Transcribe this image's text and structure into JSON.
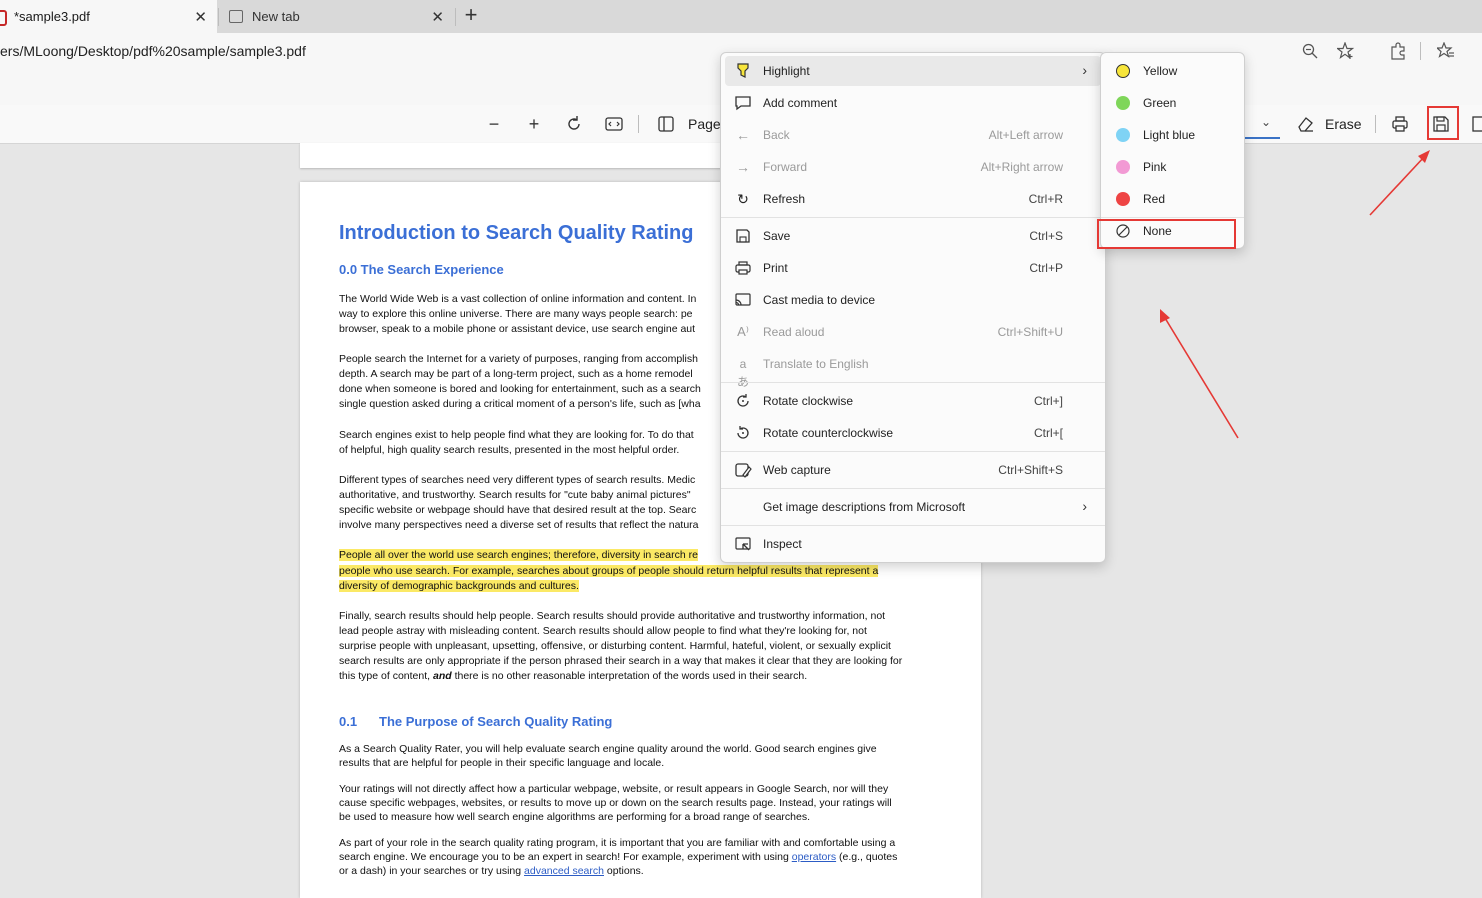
{
  "tabs": [
    {
      "title": "*sample3.pdf",
      "close": "✕"
    },
    {
      "title": "New tab",
      "close": "✕"
    }
  ],
  "new_tab_symbol": "+",
  "address": {
    "url": "ers/MLoong/Desktop/pdf%20sample/sample3.pdf"
  },
  "pdf_toolbar": {
    "page_label": "Page",
    "erase_label": "Erase",
    "icons": [
      "zoom-out-icon",
      "zoom-in-icon",
      "rotate-icon",
      "fit-width-icon",
      "page-view-icon",
      "eraser-icon",
      "print-icon",
      "save-icon"
    ]
  },
  "document": {
    "title": "Introduction to Search Quality Rating",
    "section_00": "0.0 The Search Experience",
    "p1": [
      "The World Wide Web is a vast collection of online information and content.  In",
      "way to explore this online universe.  There are many ways people search: pe",
      "browser, speak to a mobile phone or assistant device, use search engine aut"
    ],
    "p2": [
      "People search the Internet  for a variety of purposes, ranging from accomplish",
      "depth.  A search may be part of a long-term project, such as a home remodel",
      "done when someone is bored and looking for entertainment, such as a search",
      "single question asked during a critical moment of a person's life, such as [wha"
    ],
    "p3": [
      "Search engines exist to help people find what they are looking for.  To do that",
      "of helpful, high quality search results, presented in the most helpful order."
    ],
    "p4": [
      "Different types of searches need very different types of search results.  Medic",
      "authoritative, and trustworthy.  Search results for \"cute baby animal pictures\"",
      "specific website or webpage should have that desired result at the top.  Searc",
      "involve many perspectives need a diverse set of results that reflect the natura"
    ],
    "p5": [
      "People all over the world use search engines; therefore, diversity in search re",
      "people who use search.  For example, searches about groups of people should return helpful results that represent a",
      "diversity of demographic backgrounds and cultures."
    ],
    "p6": [
      "Finally, search results should help people.  Search results should provide authoritative and trustworthy information, not",
      "lead people astray with misleading content.  Search results should allow people to find what they're looking for, not",
      "surprise people with unpleasant, upsetting, offensive, or disturbing content.  Harmful, hateful, violent, or sexually explicit",
      "search results are only appropriate if the person phrased their search in a way that makes it clear that they are looking for"
    ],
    "p6_last_a": "this type of content,",
    "p6_last_b": "and",
    "p6_last_c": "there is no other reasonable interpretation of the words used in their search.",
    "section_01_num": "0.1",
    "section_01": "The Purpose of Search Quality Rating",
    "p7": [
      "As a Search Quality Rater, you will help evaluate search engine quality around the world.  Good search engines give",
      "results that are helpful for people in their specific language and locale."
    ],
    "p8": [
      "Your ratings will not directly affect how a particular webpage, website, or result appears in Google Search, nor will they",
      "cause specific webpages, websites, or results to move up or down on the search results page.  Instead, your ratings will",
      "be used to measure how well search engine algorithms are performing for a broad range of searches."
    ],
    "p9_l1": "As part of your role in the search quality rating program, it is important that you are familiar with and comfortable using a",
    "p9_l2a": "search engine.  We encourage you to be an expert in search!  For example, experiment with using",
    "p9_l2_link": "operators",
    "p9_l2b": "(e.g., quotes",
    "p9_l3a": "or a dash) in your searches or try using",
    "p9_l3_link": "advanced search",
    "p9_l3b": "options."
  },
  "context_menu": {
    "items": [
      {
        "label": "Highlight",
        "shortcut": "",
        "icon": "highlighter-icon",
        "arrow": "›"
      },
      {
        "label": "Add comment",
        "shortcut": "",
        "icon": "comment-icon"
      },
      {
        "label": "Back",
        "shortcut": "Alt+Left arrow",
        "icon": "back-arrow-icon"
      },
      {
        "label": "Forward",
        "shortcut": "Alt+Right arrow",
        "icon": "forward-arrow-icon"
      },
      {
        "label": "Refresh",
        "shortcut": "Ctrl+R",
        "icon": "refresh-icon"
      },
      {
        "label": "Save",
        "shortcut": "Ctrl+S",
        "icon": "save-icon"
      },
      {
        "label": "Print",
        "shortcut": "Ctrl+P",
        "icon": "print-icon"
      },
      {
        "label": "Cast media to device",
        "shortcut": "",
        "icon": "cast-icon"
      },
      {
        "label": "Read aloud",
        "shortcut": "Ctrl+Shift+U",
        "icon": "read-aloud-icon"
      },
      {
        "label": "Translate to English",
        "shortcut": "",
        "icon": "translate-icon"
      },
      {
        "label": "Rotate clockwise",
        "shortcut": "Ctrl+]",
        "icon": "rotate-cw-icon"
      },
      {
        "label": "Rotate counterclockwise",
        "shortcut": "Ctrl+[",
        "icon": "rotate-ccw-icon"
      },
      {
        "label": "Web capture",
        "shortcut": "Ctrl+Shift+S",
        "icon": "web-capture-icon"
      },
      {
        "label": "Get image descriptions from Microsoft",
        "shortcut": "",
        "icon": "",
        "arrow": "›"
      },
      {
        "label": "Inspect",
        "shortcut": "",
        "icon": "inspect-icon"
      }
    ]
  },
  "highlight_submenu": {
    "items": [
      {
        "label": "Yellow",
        "color": "#f7e53b"
      },
      {
        "label": "Green",
        "color": "#7fd65a"
      },
      {
        "label": "Light blue",
        "color": "#7fd3f5"
      },
      {
        "label": "Pink",
        "color": "#f29ad4"
      },
      {
        "label": "Red",
        "color": "#ee4444"
      },
      {
        "label": "None",
        "color": ""
      }
    ]
  },
  "annotation_color": "#e53935"
}
